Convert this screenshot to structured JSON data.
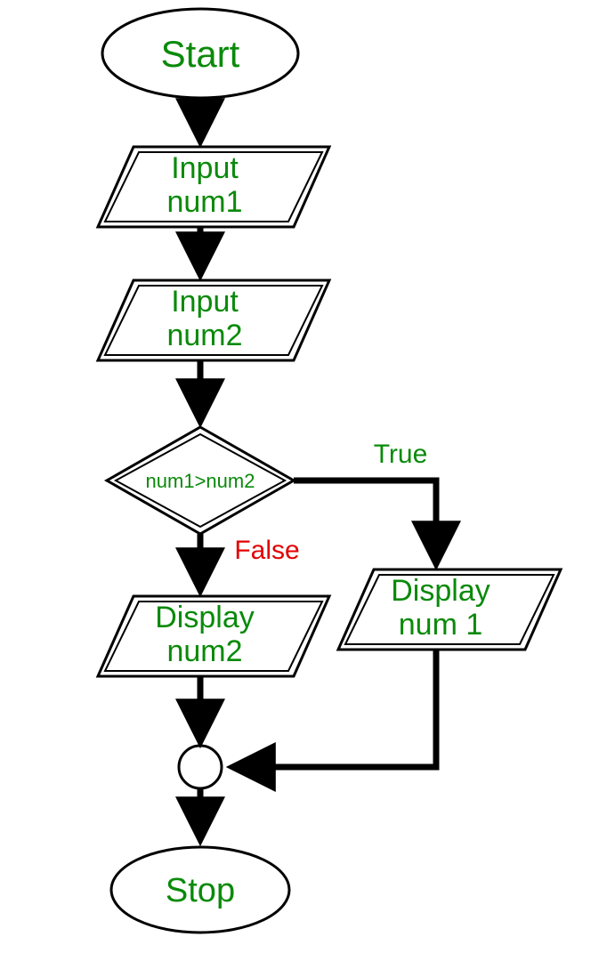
{
  "nodes": {
    "start": "Start",
    "input1_line1": "Input",
    "input1_line2": "num1",
    "input2_line1": "Input",
    "input2_line2": "num2",
    "decision": "num1>num2",
    "displayFalse_line1": "Display",
    "displayFalse_line2": "num2",
    "displayTrue_line1": "Display",
    "displayTrue_line2": "num 1",
    "stop": "Stop"
  },
  "labels": {
    "true": "True",
    "false": "False"
  },
  "colors": {
    "text_green": "#0a8a0a",
    "text_red": "#e20000",
    "stroke": "#000000"
  }
}
